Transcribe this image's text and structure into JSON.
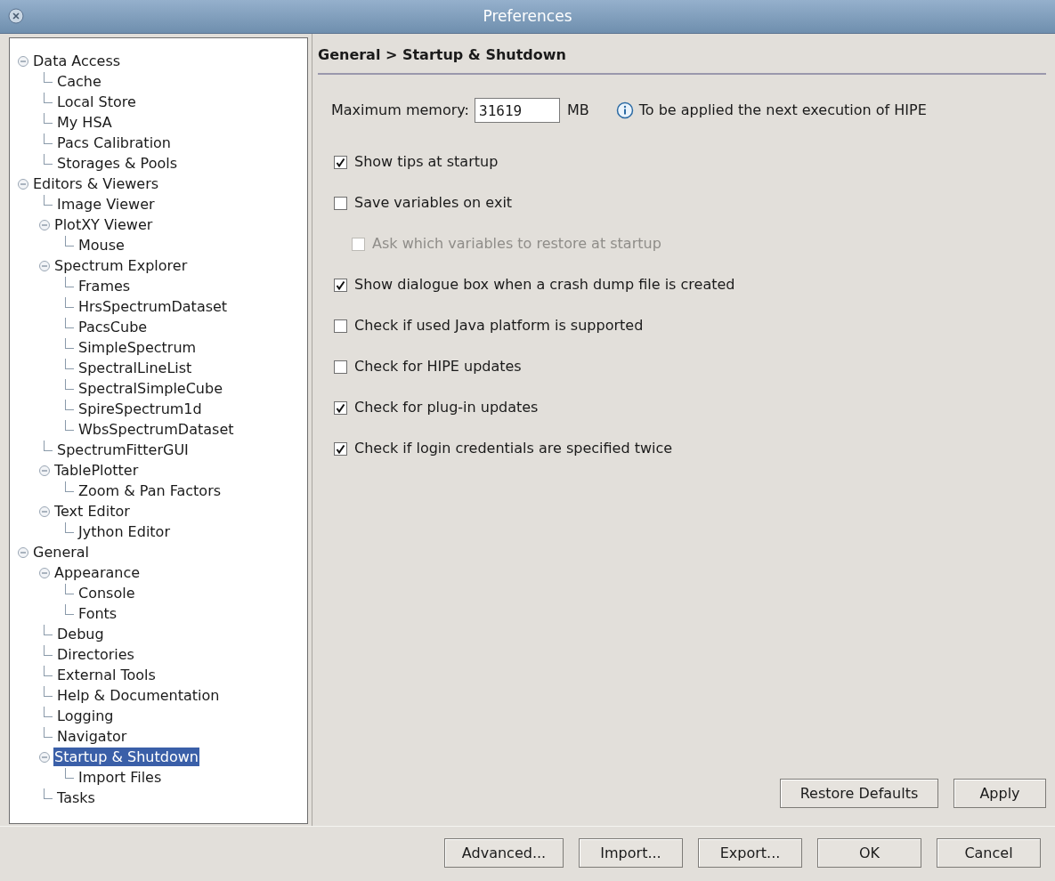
{
  "window": {
    "title": "Preferences"
  },
  "tree": [
    {
      "label": "Data Access",
      "expanded": true,
      "selected": false,
      "children": [
        {
          "label": "Cache",
          "selected": false
        },
        {
          "label": "Local Store",
          "selected": false
        },
        {
          "label": "My HSA",
          "selected": false
        },
        {
          "label": "Pacs Calibration",
          "selected": false
        },
        {
          "label": "Storages & Pools",
          "selected": false
        }
      ]
    },
    {
      "label": "Editors & Viewers",
      "expanded": true,
      "selected": false,
      "children": [
        {
          "label": "Image Viewer",
          "selected": false
        },
        {
          "label": "PlotXY Viewer",
          "expanded": true,
          "selected": false,
          "children": [
            {
              "label": "Mouse",
              "selected": false
            }
          ]
        },
        {
          "label": "Spectrum Explorer",
          "expanded": true,
          "selected": false,
          "children": [
            {
              "label": "Frames",
              "selected": false
            },
            {
              "label": "HrsSpectrumDataset",
              "selected": false
            },
            {
              "label": "PacsCube",
              "selected": false
            },
            {
              "label": "SimpleSpectrum",
              "selected": false
            },
            {
              "label": "SpectralLineList",
              "selected": false
            },
            {
              "label": "SpectralSimpleCube",
              "selected": false
            },
            {
              "label": "SpireSpectrum1d",
              "selected": false
            },
            {
              "label": "WbsSpectrumDataset",
              "selected": false
            }
          ]
        },
        {
          "label": "SpectrumFitterGUI",
          "selected": false
        },
        {
          "label": "TablePlotter",
          "expanded": true,
          "selected": false,
          "children": [
            {
              "label": "Zoom & Pan Factors",
              "selected": false
            }
          ]
        },
        {
          "label": "Text Editor",
          "expanded": true,
          "selected": false,
          "children": [
            {
              "label": "Jython Editor",
              "selected": false
            }
          ]
        }
      ]
    },
    {
      "label": "General",
      "expanded": true,
      "selected": false,
      "children": [
        {
          "label": "Appearance",
          "expanded": true,
          "selected": false,
          "children": [
            {
              "label": "Console",
              "selected": false
            },
            {
              "label": "Fonts",
              "selected": false
            }
          ]
        },
        {
          "label": "Debug",
          "selected": false
        },
        {
          "label": "Directories",
          "selected": false
        },
        {
          "label": "External Tools",
          "selected": false
        },
        {
          "label": "Help & Documentation",
          "selected": false
        },
        {
          "label": "Logging",
          "selected": false
        },
        {
          "label": "Navigator",
          "selected": false
        },
        {
          "label": "Startup & Shutdown",
          "expanded": true,
          "selected": true,
          "children": [
            {
              "label": "Import Files",
              "selected": false
            }
          ]
        },
        {
          "label": "Tasks",
          "selected": false
        }
      ]
    }
  ],
  "panel": {
    "heading": "General > Startup & Shutdown",
    "memory": {
      "label": "Maximum memory:",
      "value": "31619",
      "unit": "MB",
      "note": "To be applied the next execution of HIPE"
    },
    "options": [
      {
        "label": "Show tips at startup",
        "checked": true,
        "disabled": false
      },
      {
        "label": "Save variables on exit",
        "checked": false,
        "disabled": false,
        "children": [
          {
            "label": "Ask which variables to restore at startup",
            "checked": false,
            "disabled": true
          }
        ]
      },
      {
        "label": "Show dialogue box when a crash dump file is created",
        "checked": true,
        "disabled": false
      },
      {
        "label": "Check if used Java platform is supported",
        "checked": false,
        "disabled": false
      },
      {
        "label": "Check for HIPE updates",
        "checked": false,
        "disabled": false
      },
      {
        "label": "Check for plug-in updates",
        "checked": true,
        "disabled": false
      },
      {
        "label": "Check if login credentials are specified twice",
        "checked": true,
        "disabled": false
      }
    ],
    "buttons": [
      "Restore Defaults",
      "Apply"
    ]
  },
  "footer_buttons": [
    "Advanced...",
    "Import...",
    "Export...",
    "OK",
    "Cancel"
  ]
}
